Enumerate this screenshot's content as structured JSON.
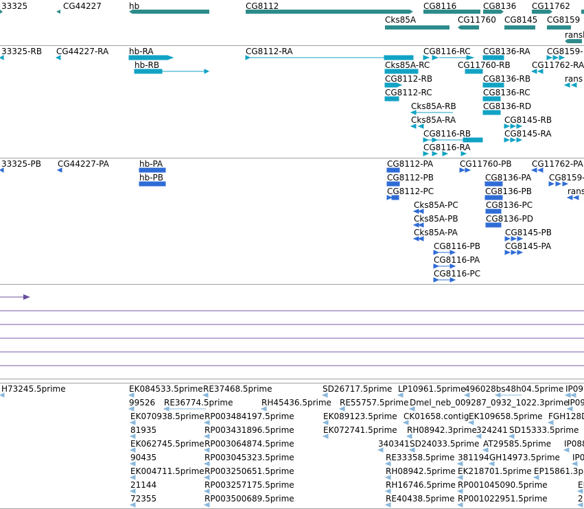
{
  "tracks": {
    "genes": {
      "labels": [
        "33325",
        "CG44227",
        "hb",
        "CG8112",
        "CG8116",
        "CG8136",
        "CG11762",
        "Cks85A",
        "CG11760",
        "CG8145",
        "CG8159",
        "ransh"
      ],
      "color": "#2e8b8b"
    },
    "transcripts": {
      "labels": [
        "33325-RB",
        "CG44227-RA",
        "hb-RA",
        "hb-RB",
        "CG8112-RA",
        "CG8116-RC",
        "CG8136-RA",
        "CG8159-",
        "Cks85A-RC",
        "CG11760-RB",
        "CG11762-RA",
        "CG8112-RB",
        "CG8136-RB",
        "rans",
        "CG8112-RC",
        "CG8136-RC",
        "Cks85A-RB",
        "CG8136-RD",
        "Cks85A-RA",
        "CG8145-RB",
        "CG8116-RB",
        "CG8145-RA",
        "CG8116-RA"
      ],
      "color": "#12a3c4"
    },
    "proteins": {
      "labels": [
        "33325-PB",
        "CG44227-PA",
        "hb-PA",
        "hb-PB",
        "CG8112-PA",
        "CG11760-PB",
        "CG11762-PA",
        "CG8112-PB",
        "CG8136-PA",
        "CG8159-",
        "CG8112-PC",
        "CG8136-PB",
        "rans",
        "Cks85A-PC",
        "CG8136-PC",
        "Cks85A-PB",
        "CG8136-PD",
        "Cks85A-PA",
        "CG8145-PB",
        "CG8116-PB",
        "CG8145-PA",
        "CG8116-PA",
        "CG8116-PC"
      ],
      "color": "#2f6cd6"
    },
    "signals": {
      "color": "#6a4fa0",
      "line_color": "#7a5aa5"
    },
    "ests": {
      "labels": [
        "H73245.5prime",
        "EK084533.5prime",
        "RE37468.5prime",
        "SD26717.5prime",
        "LP10961.5prime",
        "496028bs48h04.5prime",
        "IP09",
        "99526",
        "RE36774.5prime",
        "RH45436.5prime",
        "RE55757.5prime",
        "Dmel_neb_009287_0932_1022.3prime",
        "IP09",
        "EK070938.5prime",
        "RP003484197.5prime",
        "EK089123.5prime",
        "CK01658.contig",
        "EK109658.5prime",
        "FGH128D",
        "81935",
        "RP003431896.5prime",
        "EK072741.5prime",
        "RH08942.3prime",
        "324241",
        "SD15333.5prime",
        "EK062745.5prime",
        "RP003064874.5prime",
        "340341",
        "SD24033.5prime",
        "AT29585.5prime",
        "IP088",
        "90435",
        "RP003045323.5prime",
        "RE33358.5prime",
        "381194",
        "GH14973.5prime",
        "IP0",
        "EK004711.5prime",
        "RP003250651.5prime",
        "RH08942.5prime",
        "EK218701.5prime",
        "EP15861.3p",
        "21144",
        "RP003257175.5prime",
        "RH16746.5prime",
        "RP001045090.5prime",
        "EI",
        "72355",
        "RP003500689.5prime",
        "RE40438.5prime",
        "RP001022951.5prime",
        "2"
      ],
      "color": "#8ab8dc"
    }
  }
}
